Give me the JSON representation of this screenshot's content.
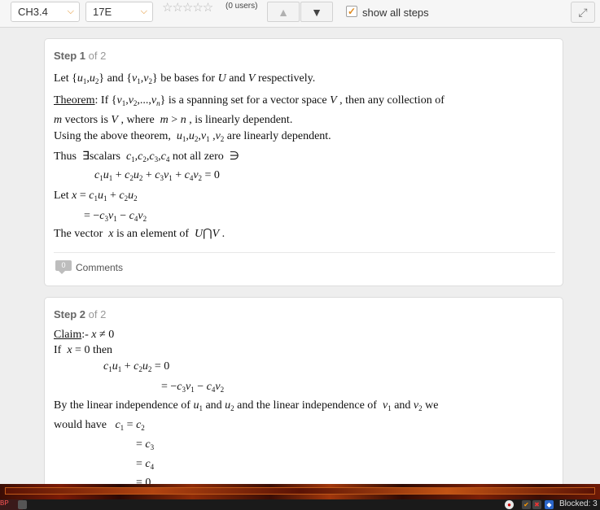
{
  "toolbar": {
    "chapter_select": "CH3.4",
    "problem_select": "17E",
    "rating_stars": "☆☆☆☆☆",
    "rating_users": "(0 users)",
    "up_arrow": "▲",
    "down_arrow": "▼",
    "show_all_steps_checked": true,
    "show_all_steps_label": "show all steps",
    "fullscreen_icon": "⤢"
  },
  "step1": {
    "label": "Step 1",
    "of": "of 2",
    "comments_count": "0",
    "comments_label": "Comments"
  },
  "step2": {
    "label": "Step 2",
    "of": "of 2"
  },
  "statusbar": {
    "blocked_label": "Blocked: 3"
  }
}
